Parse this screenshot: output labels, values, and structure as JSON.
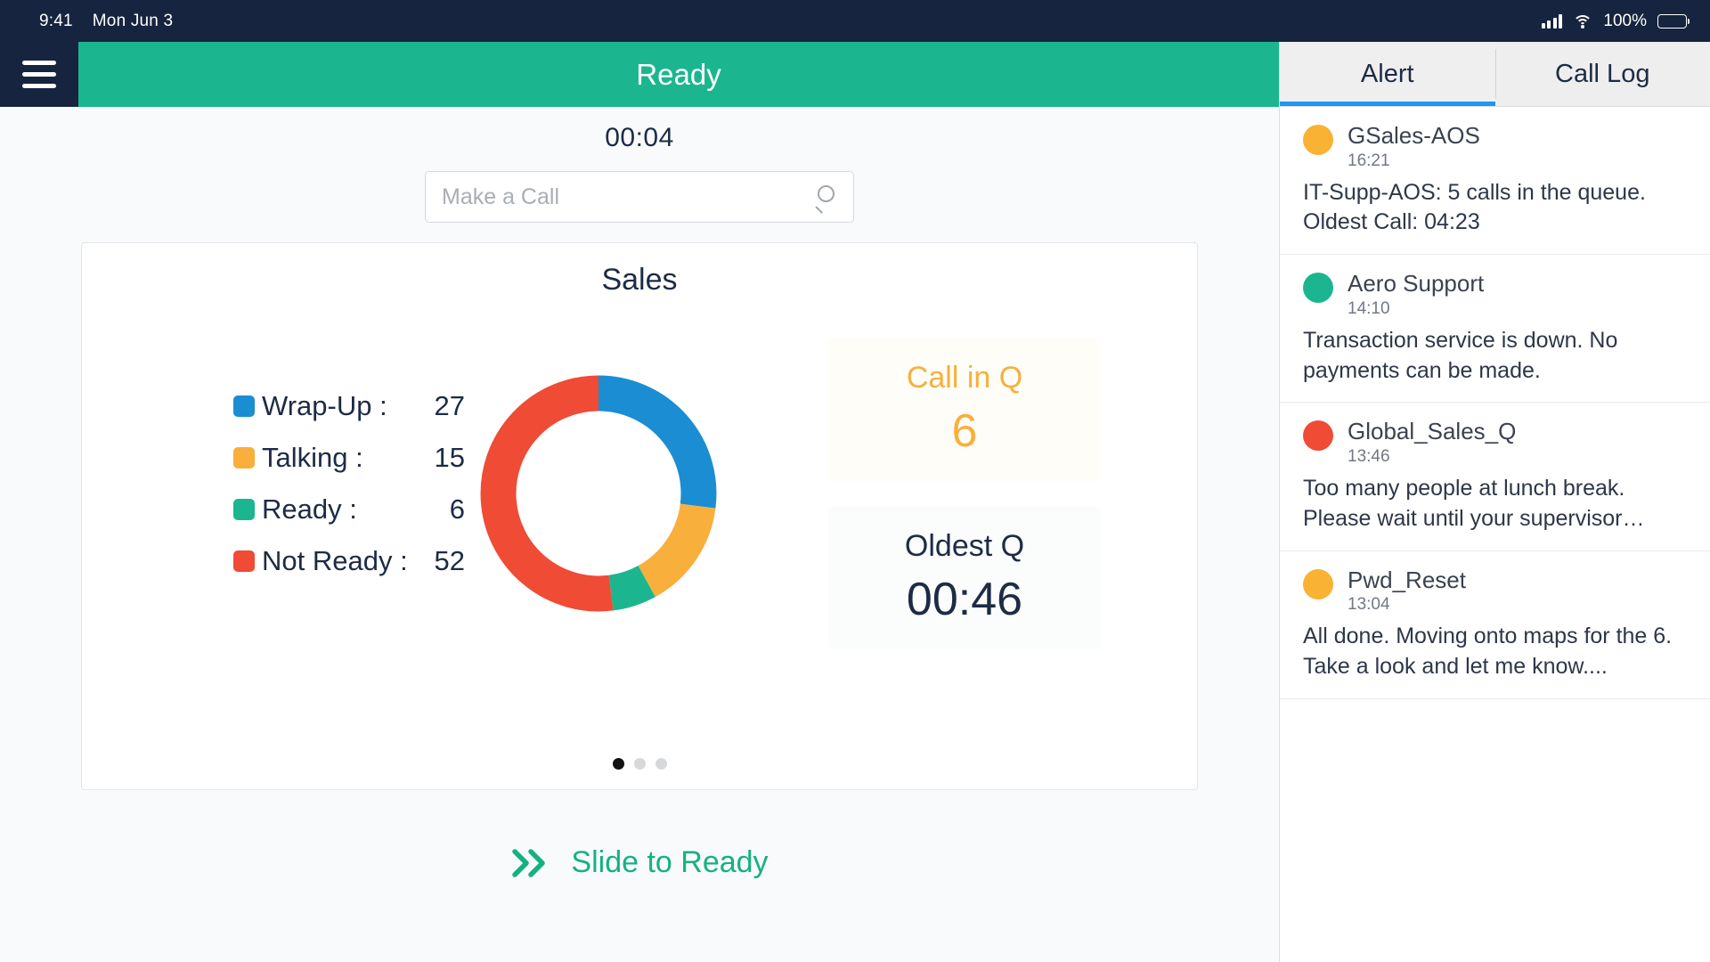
{
  "statusbar": {
    "time": "9:41",
    "date": "Mon Jun 3",
    "battery_percent": "100%",
    "signal_icon": "cellular-signal-icon",
    "wifi_icon": "wifi-icon",
    "battery_icon": "battery-icon"
  },
  "topbar": {
    "menu_icon": "hamburger-menu-icon",
    "agent_status": "Ready",
    "status_color": "#1bb68f"
  },
  "timer": {
    "value": "00:04"
  },
  "search": {
    "placeholder": "Make a Call",
    "value": "",
    "icon": "search-icon"
  },
  "card": {
    "title": "Sales",
    "pagination": {
      "total": 3,
      "active_index": 0
    }
  },
  "chart_data": {
    "type": "pie",
    "title": "Sales",
    "categories": [
      "Wrap-Up",
      "Talking",
      "Ready",
      "Not Ready"
    ],
    "values": [
      27,
      15,
      6,
      52
    ],
    "colors": [
      "#1b8dd2",
      "#f9af3c",
      "#1bb68f",
      "#ef4b35"
    ],
    "labels": [
      "Wrap-Up :",
      "Talking :",
      "Ready :",
      "Not Ready :"
    ],
    "legend_position": "left",
    "donut": true,
    "inner_radius_ratio": 0.62,
    "start_angle": 0,
    "total": 100
  },
  "kpis": [
    {
      "label": "Call in Q",
      "value": "6",
      "color": "#f9af3c"
    },
    {
      "label": "Oldest Q",
      "value": "00:46",
      "color": "#1d2b45"
    }
  ],
  "slide_action": {
    "label": "Slide to Ready",
    "icon": "double-chevron-right-icon",
    "color": "#16b183"
  },
  "right_panel": {
    "tabs": [
      {
        "label": "Alert",
        "active": true
      },
      {
        "label": "Call Log",
        "active": false
      }
    ],
    "alerts": [
      {
        "title": "GSales-AOS",
        "time": "16:21",
        "text": "IT-Supp-AOS: 5 calls in the queue. Oldest Call: 04:23",
        "dot_color": "#f9b233"
      },
      {
        "title": "Aero Support",
        "time": "14:10",
        "text": "Transaction service is down. No payments can be made.",
        "dot_color": "#1bb68f"
      },
      {
        "title": "Global_Sales_Q",
        "time": "13:46",
        "text": "Too many people at lunch break. Please wait until your supervisor…",
        "dot_color": "#ef4b35"
      },
      {
        "title": "Pwd_Reset",
        "time": "13:04",
        "text": "All done. Moving onto maps for the 6. Take a look and let me know....",
        "dot_color": "#f9b233"
      }
    ]
  }
}
